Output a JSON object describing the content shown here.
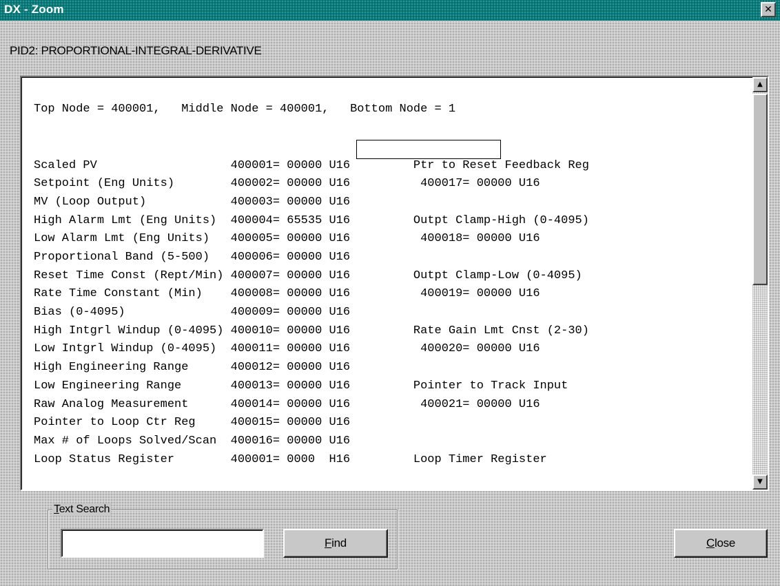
{
  "window": {
    "title": "DX - Zoom",
    "close_glyph": "✕"
  },
  "subtitle": "PID2: PROPORTIONAL-INTEGRAL-DERIVATIVE",
  "display": {
    "lines": [
      "Top Node = 400001,   Middle Node = 400001,   Bottom Node = 1",
      "",
      "Scaled PV                   400001= 00000 U16         Ptr to Reset Feedback Reg",
      "Setpoint (Eng Units)        400002= 00000 U16          400017= 00000 U16",
      "MV (Loop Output)            400003= 00000 U16",
      "High Alarm Lmt (Eng Units)  400004= 65535 U16         Outpt Clamp-High (0-4095)",
      "Low Alarm Lmt (Eng Units)   400005= 00000 U16          400018= 00000 U16",
      "Proportional Band (5-500)   400006= 00000 U16",
      "Reset Time Const (Rept/Min) 400007= 00000 U16         Outpt Clamp-Low (0-4095)",
      "Rate Time Constant (Min)    400008= 00000 U16          400019= 00000 U16",
      "Bias (0-4095)               400009= 00000 U16",
      "High Intgrl Windup (0-4095) 400010= 00000 U16         Rate Gain Lmt Cnst (2-30)",
      "Low Intgrl Windup (0-4095)  400011= 00000 U16          400020= 00000 U16",
      "High Engineering Range      400012= 00000 U16",
      "Low Engineering Range       400013= 00000 U16         Pointer to Track Input",
      "Raw Analog Measurement      400014= 00000 U16          400021= 00000 U16",
      "Pointer to Loop Ctr Reg     400015= 00000 U16",
      "Max # of Loops Solved/Scan  400016= 00000 U16",
      "Loop Status Register        400001= 0000  H16         Loop Timer Register"
    ],
    "scroll_up_glyph": "▲",
    "scroll_down_glyph": "▼"
  },
  "search": {
    "group_label_accel": "T",
    "group_label_rest": "ext Search",
    "value": "",
    "find_accel": "F",
    "find_rest": "ind"
  },
  "close_button": {
    "accel": "C",
    "rest": "lose"
  }
}
